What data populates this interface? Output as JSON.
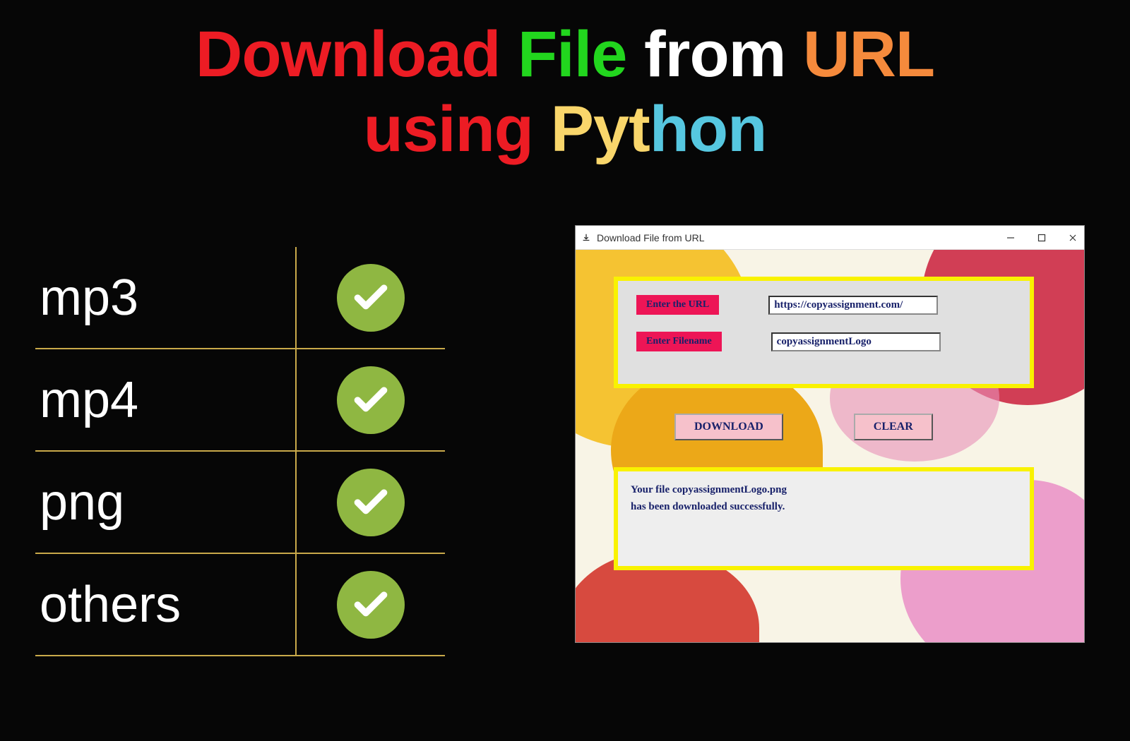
{
  "title": {
    "w1": "Download",
    "w2": "File",
    "w3": "from",
    "w4": "URL",
    "w5": "using",
    "w6a": "Pyt",
    "w6b": "hon"
  },
  "table": {
    "rows": [
      {
        "label": "mp3"
      },
      {
        "label": "mp4"
      },
      {
        "label": "png"
      },
      {
        "label": "others"
      }
    ]
  },
  "window": {
    "title": "Download File from URL",
    "form": {
      "url_label": "Enter the URL",
      "url_value": "https://copyassignment.com/",
      "filename_label": "Enter Filename",
      "filename_value": "copyassignmentLogo"
    },
    "buttons": {
      "download": "DOWNLOAD",
      "clear": "CLEAR"
    },
    "status_line1": "Your file copyassignmentLogo.png",
    "status_line2": " has been downloaded successfully."
  }
}
